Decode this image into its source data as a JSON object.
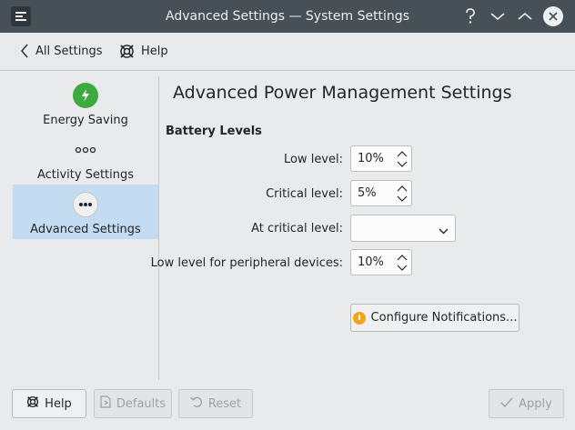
{
  "window": {
    "title": "Advanced Settings  — System Settings",
    "controls": [
      "help-icon",
      "minimize-icon",
      "maximize-icon",
      "close-icon"
    ]
  },
  "topnav": {
    "back_label": "All Settings",
    "help_label": "Help"
  },
  "sidebar": {
    "items": [
      {
        "label": "Energy Saving",
        "icon": "lightning-icon",
        "selected": false
      },
      {
        "label": "Activity Settings",
        "icon": "activity-dots-icon",
        "selected": false
      },
      {
        "label": "Advanced Settings",
        "icon": "more-dots-icon",
        "selected": true
      }
    ]
  },
  "main": {
    "title": "Advanced Power Management Settings",
    "section": "Battery Levels",
    "fields": {
      "low_level": {
        "label": "Low level:",
        "value": "10%"
      },
      "critical_level": {
        "label": "Critical level:",
        "value": "5%"
      },
      "at_critical": {
        "label": "At critical level:",
        "value": ""
      },
      "peripheral": {
        "label": "Low level for peripheral devices:",
        "value": "10%"
      }
    },
    "configure_notifications_label": "Configure Notifications..."
  },
  "footer": {
    "help_label": "Help",
    "defaults_label": "Defaults",
    "reset_label": "Reset",
    "apply_label": "Apply"
  },
  "colors": {
    "titlebar": "#475057",
    "selection": "#c3dcf2",
    "energy_icon": "#3daa3d",
    "warning": "#f3a51c"
  }
}
